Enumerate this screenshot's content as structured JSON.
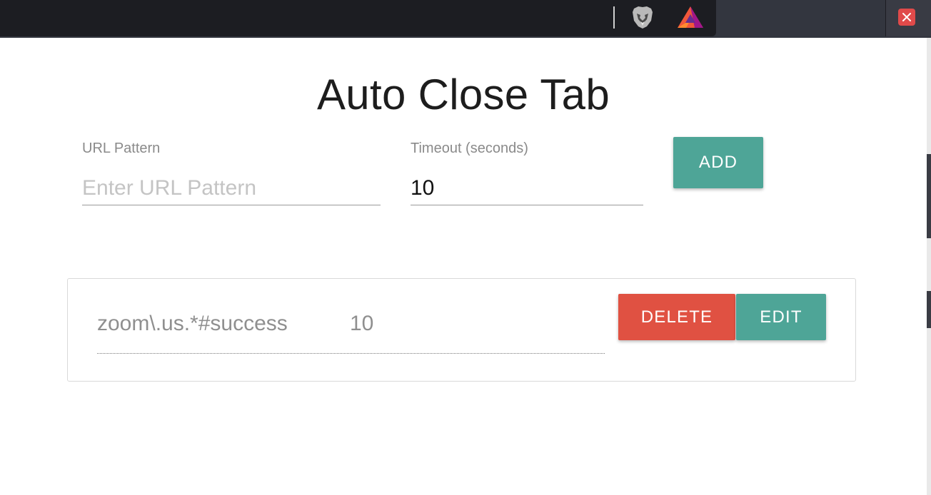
{
  "title": "Auto Close Tab",
  "form": {
    "url_label": "URL Pattern",
    "url_placeholder": "Enter URL Pattern",
    "url_value": "",
    "timeout_label": "Timeout (seconds)",
    "timeout_value": "10",
    "add_label": "ADD"
  },
  "rules": [
    {
      "pattern": "zoom\\.us.*#success",
      "timeout": "10",
      "delete_label": "DELETE",
      "edit_label": "EDIT"
    }
  ],
  "toolbar": {
    "icons": [
      "brave-lion-icon",
      "bat-triangle-icon",
      "close-icon"
    ]
  },
  "colors": {
    "accent_teal": "#4ea597",
    "danger_red": "#e05142",
    "toolbar_dark": "#1c1d22",
    "close_red": "#e04a4a"
  }
}
